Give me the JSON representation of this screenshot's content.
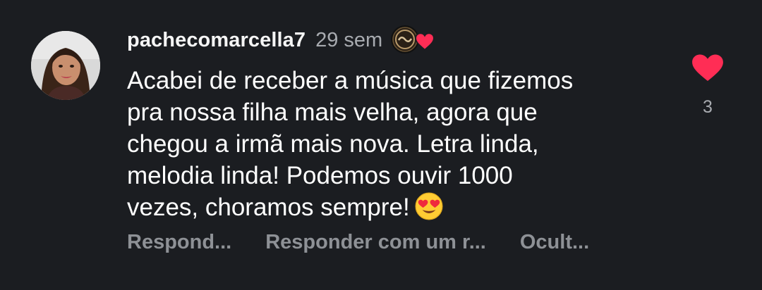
{
  "comment": {
    "username": "pachecomarcella7",
    "timestamp": "29 sem",
    "text_lines": [
      "Acabei de receber a música que fizemos",
      "pra nossa filha mais velha, agora que",
      "chegou a irmã mais nova. Letra linda,",
      "melodia linda! Podemos ouvir 1000",
      "vezes, choramos sempre!"
    ],
    "emoji": "heart-eyes-emoji",
    "like_count": "3",
    "liked_by_creator": true,
    "liked": true
  },
  "actions": {
    "reply": "Respond...",
    "reply_with_meme": "Responder com um r...",
    "hide": "Ocult..."
  },
  "colors": {
    "background": "#1b1d21",
    "heart": "#ff2d55",
    "secondary_text": "#a8abb0",
    "action_text": "#8e9196"
  },
  "icons": [
    "avatar",
    "creator-avatar",
    "heart-icon",
    "heart-eyes-emoji"
  ]
}
